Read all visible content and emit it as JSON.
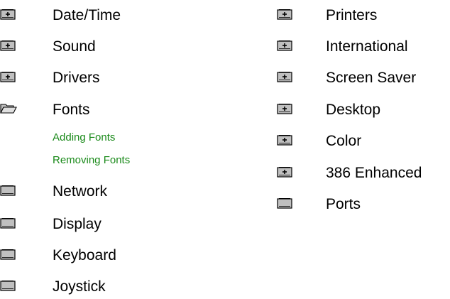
{
  "colors": {
    "subtopic_link": "#1a8a1a",
    "folder_fill": "#c0c0c0",
    "folder_outline": "#000000"
  },
  "left_column": {
    "items": [
      {
        "label": "Date/Time",
        "icon": "closed-book-plus-icon"
      },
      {
        "label": "Sound",
        "icon": "closed-book-plus-icon"
      },
      {
        "label": "Drivers",
        "icon": "closed-book-plus-icon"
      },
      {
        "label": "Fonts",
        "icon": "open-book-icon"
      },
      {
        "label": "Network",
        "icon": "closed-book-icon"
      },
      {
        "label": "Display",
        "icon": "closed-book-icon"
      },
      {
        "label": "Keyboard",
        "icon": "closed-book-icon"
      },
      {
        "label": "Joystick",
        "icon": "closed-book-icon"
      }
    ],
    "fonts_subtopics": [
      "Adding Fonts",
      "Removing Fonts"
    ]
  },
  "right_column": {
    "items": [
      {
        "label": "Printers",
        "icon": "closed-book-plus-icon"
      },
      {
        "label": "International",
        "icon": "closed-book-plus-icon"
      },
      {
        "label": "Screen Saver",
        "icon": "closed-book-plus-icon"
      },
      {
        "label": "Desktop",
        "icon": "closed-book-plus-icon"
      },
      {
        "label": "Color",
        "icon": "closed-book-plus-icon"
      },
      {
        "label": "386 Enhanced",
        "icon": "closed-book-plus-icon"
      },
      {
        "label": "Ports",
        "icon": "closed-book-icon"
      }
    ]
  }
}
